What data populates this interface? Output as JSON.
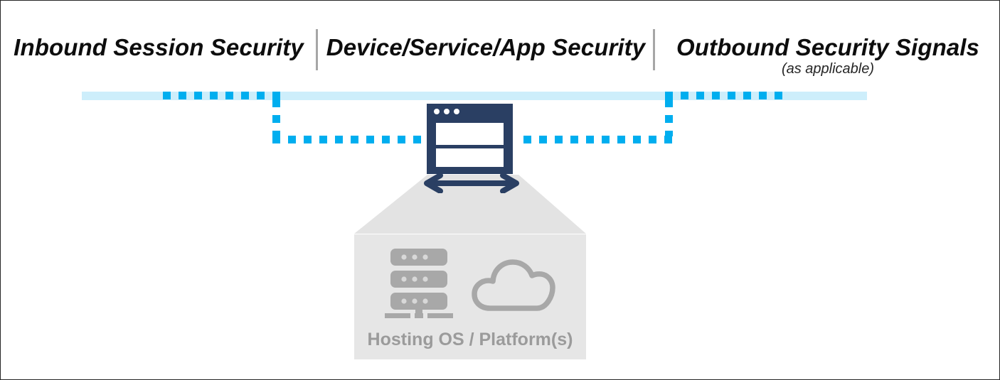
{
  "diagram": {
    "title_columns": [
      {
        "id": "inbound",
        "label": "Inbound Session Security"
      },
      {
        "id": "device",
        "label": "Device/Service/App Security"
      },
      {
        "id": "outbound",
        "label": "Outbound Security Signals",
        "sublabel": "(as applicable)"
      }
    ],
    "center_node": {
      "name": "device-service-app-window",
      "icon": "browser-window-icon",
      "titlebar_dots": 3,
      "panels": 2
    },
    "connector": {
      "name": "bidirectional-arrow",
      "icon": "double-headed-arrow-icon",
      "direction": "bidirectional"
    },
    "platform": {
      "label": "Hosting OS / Platform(s)",
      "icons": [
        {
          "name": "server-rack-icon",
          "units": 3,
          "dots_per_unit": 3
        },
        {
          "name": "cloud-icon"
        }
      ]
    },
    "flow_paths": [
      {
        "name": "inbound-session-path",
        "style": "dashed",
        "side": "left"
      },
      {
        "name": "outbound-signal-path",
        "style": "dashed",
        "side": "right"
      }
    ],
    "colors": {
      "accent_blue": "#00AEEF",
      "band_blue": "#CDEEFB",
      "navy": "#2A3F63",
      "platform_gray": "#E6E6E6",
      "trapezoid_gray": "#E3E3E3",
      "label_gray": "#9B9B9B",
      "divider_gray": "#A6A6A6",
      "text_dark": "#0D0D0D",
      "background": "#FFFFFF",
      "border": "#262626"
    }
  }
}
